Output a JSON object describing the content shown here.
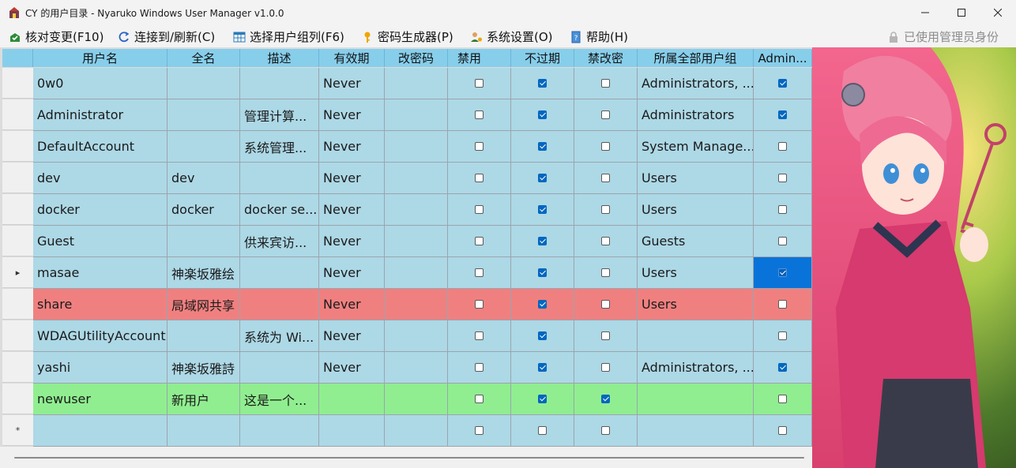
{
  "window": {
    "title": "CY 的用户目录 - Nyaruko Windows User Manager v1.0.0"
  },
  "menu": [
    {
      "label": "核对变更(F10)",
      "icon": "check-changes-icon"
    },
    {
      "label": "连接到/刷新(C)",
      "icon": "refresh-icon"
    },
    {
      "label": "选择用户组列(F6)",
      "icon": "table-columns-icon"
    },
    {
      "label": "密码生成器(P)",
      "icon": "key-icon"
    },
    {
      "label": "系统设置(O)",
      "icon": "user-settings-icon"
    },
    {
      "label": "帮助(H)",
      "icon": "help-book-icon"
    }
  ],
  "status": {
    "admin_label": "已使用管理员身份"
  },
  "table": {
    "columns": [
      "用户名",
      "全名",
      "描述",
      "有效期",
      "改密码",
      "禁用",
      "不过期",
      "禁改密",
      "所属全部用户组",
      "Admin..."
    ],
    "rows": [
      {
        "marker": "",
        "name": "0w0",
        "fullname": "",
        "desc": "",
        "expiry": "Never",
        "chpw": "",
        "disabled": false,
        "noexpire": true,
        "nochange": false,
        "groups": "Administrators, ...",
        "admin": true,
        "style": "normal"
      },
      {
        "marker": "",
        "name": "Administrator",
        "fullname": "",
        "desc": "管理计算...",
        "expiry": "Never",
        "chpw": "",
        "disabled": false,
        "noexpire": true,
        "nochange": false,
        "groups": "Administrators",
        "admin": true,
        "style": "normal"
      },
      {
        "marker": "",
        "name": "DefaultAccount",
        "fullname": "",
        "desc": "系统管理...",
        "expiry": "Never",
        "chpw": "",
        "disabled": false,
        "noexpire": true,
        "nochange": false,
        "groups": "System Manage...",
        "admin": false,
        "style": "normal"
      },
      {
        "marker": "",
        "name": "dev",
        "fullname": "dev",
        "desc": "",
        "expiry": "Never",
        "chpw": "",
        "disabled": false,
        "noexpire": true,
        "nochange": false,
        "groups": "Users",
        "admin": false,
        "style": "normal"
      },
      {
        "marker": "",
        "name": "docker",
        "fullname": "docker",
        "desc": "docker se...",
        "expiry": "Never",
        "chpw": "",
        "disabled": false,
        "noexpire": true,
        "nochange": false,
        "groups": "Users",
        "admin": false,
        "style": "normal"
      },
      {
        "marker": "",
        "name": "Guest",
        "fullname": "",
        "desc": "供来宾访...",
        "expiry": "Never",
        "chpw": "",
        "disabled": false,
        "noexpire": true,
        "nochange": false,
        "groups": "Guests",
        "admin": false,
        "style": "normal"
      },
      {
        "marker": "▸",
        "name": "masae",
        "fullname": "神楽坂雅绘",
        "desc": "",
        "expiry": "Never",
        "chpw": "",
        "disabled": false,
        "noexpire": true,
        "nochange": false,
        "groups": "Users",
        "admin": true,
        "style": "normal",
        "selected_col": 9
      },
      {
        "marker": "",
        "name": "share",
        "fullname": "局域网共享",
        "desc": "",
        "expiry": "Never",
        "chpw": "",
        "disabled": false,
        "noexpire": true,
        "nochange": false,
        "groups": "Users",
        "admin": false,
        "style": "red"
      },
      {
        "marker": "",
        "name": "WDAGUtilityAccount",
        "fullname": "",
        "desc": "系统为 Wi...",
        "expiry": "Never",
        "chpw": "",
        "disabled": false,
        "noexpire": true,
        "nochange": false,
        "groups": "",
        "admin": false,
        "style": "normal"
      },
      {
        "marker": "",
        "name": "yashi",
        "fullname": "神楽坂雅詩",
        "desc": "",
        "expiry": "Never",
        "chpw": "",
        "disabled": false,
        "noexpire": true,
        "nochange": false,
        "groups": "Administrators, ...",
        "admin": true,
        "style": "normal"
      },
      {
        "marker": "",
        "name": "newuser",
        "fullname": "新用户",
        "desc": "这是一个...",
        "expiry": "",
        "chpw": "",
        "disabled": false,
        "noexpire": true,
        "nochange": true,
        "groups": "",
        "admin": false,
        "style": "green"
      },
      {
        "marker": "*",
        "name": "",
        "fullname": "",
        "desc": "",
        "expiry": "",
        "chpw": "",
        "disabled": false,
        "noexpire": false,
        "nochange": false,
        "groups": "",
        "admin": false,
        "style": "normal"
      }
    ]
  },
  "colors": {
    "header_bg": "#87ceeb",
    "row_bg": "#a9d8e6",
    "row_alt_bg": "#add8e6",
    "red_row_bg": "#f08080",
    "green_row_bg": "#90ee90",
    "selected_bg": "#0a73d9",
    "accent": "#0067c0"
  }
}
